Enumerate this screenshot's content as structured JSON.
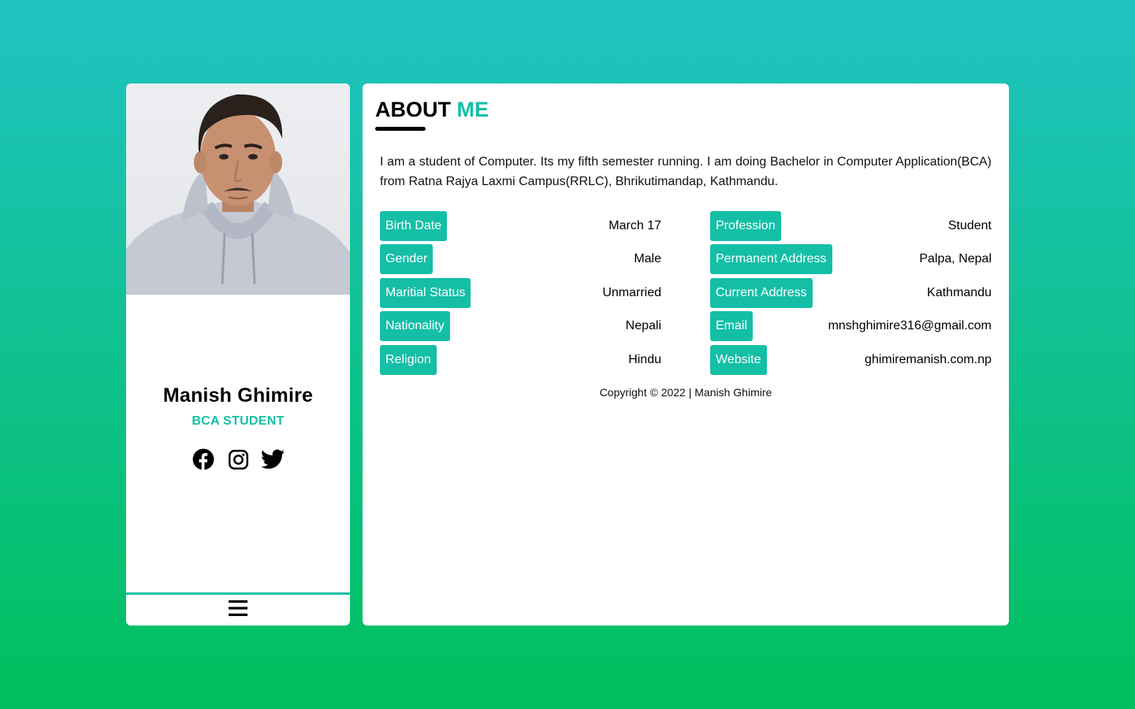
{
  "profile": {
    "name": "Manish Ghimire",
    "role": "BCA STUDENT",
    "social_icons": [
      "facebook-icon",
      "instagram-icon",
      "twitter-icon"
    ],
    "menu_icon": "hamburger-menu-icon"
  },
  "about": {
    "title_main": "ABOUT",
    "title_accent": "ME",
    "bio": "I am a student of Computer. Its my fifth semester running. I am doing Bachelor in Computer Application(BCA) from Ratna Rajya Laxmi Campus(RRLC), Bhrikutimandap, Kathmandu.",
    "left_details": [
      {
        "label": "Birth Date",
        "value": "March 17"
      },
      {
        "label": "Gender",
        "value": "Male"
      },
      {
        "label": "Maritial Status",
        "value": "Unmarried"
      },
      {
        "label": "Nationality",
        "value": "Nepali"
      },
      {
        "label": "Religion",
        "value": "Hindu"
      }
    ],
    "right_details": [
      {
        "label": "Profession",
        "value": "Student"
      },
      {
        "label": "Permanent Address",
        "value": "Palpa, Nepal"
      },
      {
        "label": "Current Address",
        "value": "Kathmandu"
      },
      {
        "label": "Email",
        "value": "mnshghimire316@gmail.com"
      },
      {
        "label": "Website",
        "value": "ghimiremanish.com.np"
      }
    ],
    "copyright": "Copyright © 2022 | Manish Ghimire"
  },
  "colors": {
    "accent": "#14bfa6",
    "background_top": "#20c3c3",
    "background_bottom": "#00bf5c"
  }
}
